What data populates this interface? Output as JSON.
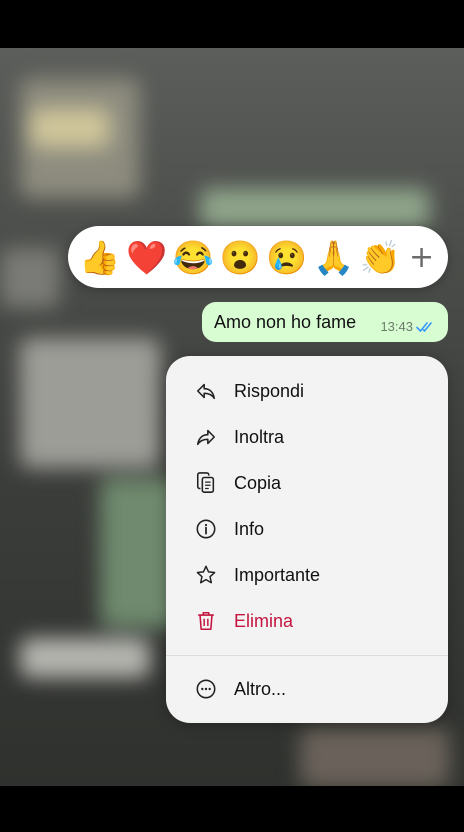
{
  "reactions": {
    "emojis": [
      {
        "name": "thumbs-up",
        "glyph": "👍"
      },
      {
        "name": "red-heart",
        "glyph": "❤️"
      },
      {
        "name": "tears-of-joy",
        "glyph": "😂"
      },
      {
        "name": "surprised",
        "glyph": "😮"
      },
      {
        "name": "crying",
        "glyph": "😢"
      },
      {
        "name": "folded-hands",
        "glyph": "🙏"
      },
      {
        "name": "clapping-hands",
        "glyph": "👏"
      }
    ],
    "more": "+"
  },
  "message": {
    "text": "Amo non ho fame",
    "time": "13:43",
    "status_icon": "double-check-read-icon"
  },
  "menu": {
    "items": [
      {
        "label": "Rispondi",
        "icon": "reply-icon"
      },
      {
        "label": "Inoltra",
        "icon": "forward-icon"
      },
      {
        "label": "Copia",
        "icon": "copy-icon"
      },
      {
        "label": "Info",
        "icon": "info-icon"
      },
      {
        "label": "Importante",
        "icon": "star-icon"
      },
      {
        "label": "Elimina",
        "icon": "trash-icon"
      },
      {
        "label": "Altro...",
        "icon": "more-icon"
      }
    ]
  },
  "colors": {
    "bubble": "#d9fdd3",
    "danger": "#c4153f",
    "read_ticks": "#3497f9"
  }
}
